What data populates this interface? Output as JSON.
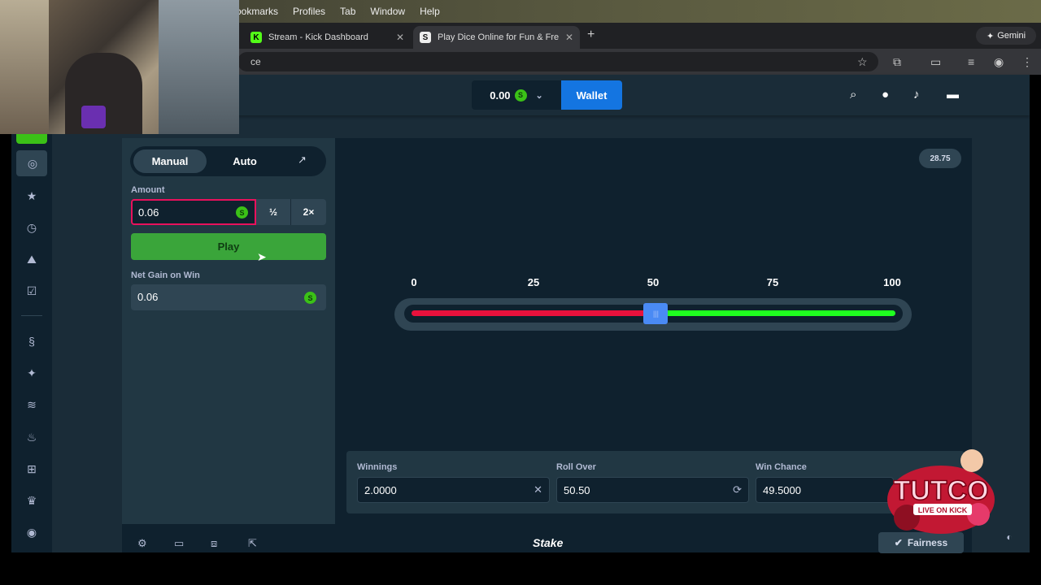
{
  "browser": {
    "menu": [
      "ookmarks",
      "Profiles",
      "Tab",
      "Window",
      "Help"
    ],
    "tabs": [
      {
        "title": "Stream - Kick Dashboard",
        "icon": "K"
      },
      {
        "title": "Play Dice Online for Fun & Fre",
        "icon": "S"
      }
    ],
    "url_fragment": "ce",
    "gemini_label": "Gemini"
  },
  "header": {
    "balance": "0.00",
    "wallet_label": "Wallet"
  },
  "panel": {
    "mode_manual": "Manual",
    "mode_auto": "Auto",
    "amount_label": "Amount",
    "amount_value": "0.06",
    "half_label": "½",
    "double_label": "2×",
    "play_label": "Play",
    "net_gain_label": "Net Gain on Win",
    "net_gain_value": "0.06",
    "coin_symbol": "S"
  },
  "game": {
    "last_roll": "28.75",
    "ticks": [
      "0",
      "25",
      "50",
      "75",
      "100"
    ],
    "roll_over_position": 0.505,
    "winnings_label": "Winnings",
    "winnings_value": "2.0000",
    "roll_over_label": "Roll Over",
    "roll_over_value": "50.50",
    "win_chance_label": "Win Chance",
    "win_chance_value": "49.5000"
  },
  "footer": {
    "brand": "Stake",
    "fairness_label": "Fairness"
  },
  "overlay": {
    "logo_text": "TUTCO",
    "logo_sub": "LIVE ON KICK"
  },
  "colors": {
    "accent_green": "#1fff20",
    "accent_red": "#e9113c",
    "wallet_blue": "#1475e1",
    "play_green": "#3aa53a"
  }
}
